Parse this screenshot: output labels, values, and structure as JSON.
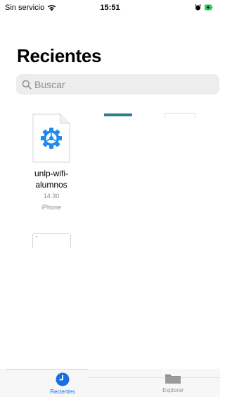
{
  "status_bar": {
    "carrier": "Sin servicio",
    "time": "15:51"
  },
  "title": "Recientes",
  "search": {
    "placeholder": "Buscar"
  },
  "files": [
    {
      "name_line1": "unlp-wifi-",
      "name_line2": "alumnos",
      "time": "14:30",
      "location": "iPhone",
      "icon": "gear-icon"
    }
  ],
  "tab_bar": {
    "tabs": [
      {
        "label": "Recientes",
        "icon": "clock-icon",
        "selected": true
      },
      {
        "label": "Explorar",
        "icon": "folder-icon",
        "selected": false
      }
    ]
  },
  "colors": {
    "accent": "#1a6fe0",
    "secondary_text": "#8e8e93",
    "search_bg": "#ededee",
    "doc_icon_blue": "#1d8af0",
    "battery_green": "#34c759"
  }
}
